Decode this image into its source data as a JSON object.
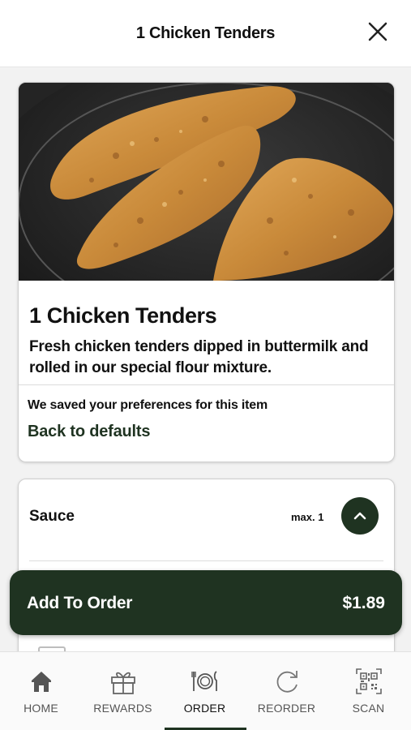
{
  "header": {
    "title": "1 Chicken Tenders"
  },
  "product": {
    "name": "1 Chicken Tenders",
    "description": "Fresh chicken tenders dipped in buttermilk and rolled in our special flour mixture.",
    "saved_text": "We saved your preferences for this item",
    "back_link": "Back to defaults"
  },
  "sauce": {
    "label": "Sauce",
    "max": "max. 1"
  },
  "order": {
    "label": "Add To Order",
    "price": "$1.89"
  },
  "nav": {
    "items": [
      {
        "label": "HOME",
        "icon": "home-icon"
      },
      {
        "label": "REWARDS",
        "icon": "gift-icon"
      },
      {
        "label": "ORDER",
        "icon": "utensils-icon"
      },
      {
        "label": "REORDER",
        "icon": "refresh-icon"
      },
      {
        "label": "SCAN",
        "icon": "qr-code-icon"
      }
    ],
    "active": "ORDER"
  },
  "colors": {
    "brand_dark_green": "#1f3321",
    "text": "#111111",
    "nav_text": "#555555"
  }
}
